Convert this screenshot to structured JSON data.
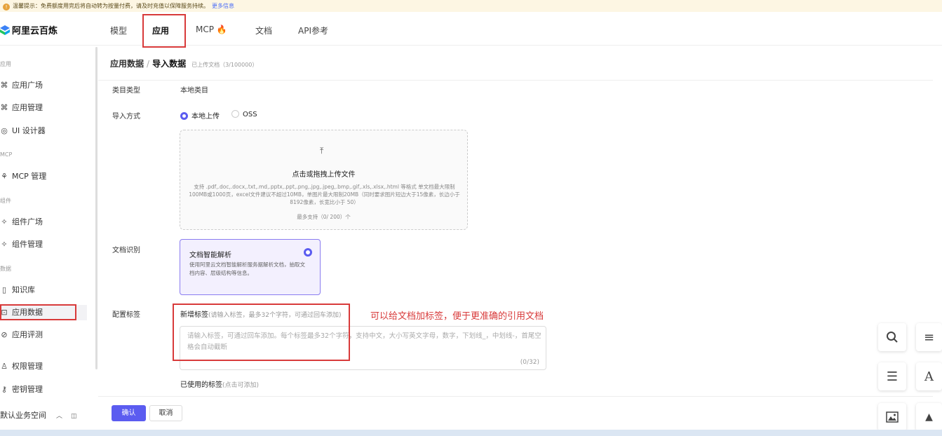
{
  "notice": {
    "text": "温馨提示：免费额度用完后将自动转为按量付费，请及时充值以保障服务持续。",
    "more": "更多信息"
  },
  "topbar": {
    "logo": "阿里云百炼",
    "nav": [
      "模型",
      "应用",
      "MCP",
      "文档",
      "API参考"
    ],
    "active_nav": "应用"
  },
  "sidebar": {
    "groups": {
      "app": "应用",
      "mcp": "MCP",
      "component": "组件",
      "data": "数据"
    },
    "items": {
      "app_plaza": "应用广场",
      "app_manage": "应用管理",
      "ui_designer": "UI 设计器",
      "mcp_manage": "MCP 管理",
      "comp_plaza": "组件广场",
      "comp_manage": "组件管理",
      "knowledge": "知识库",
      "app_data": "应用数据",
      "app_eval": "应用评测",
      "perm": "权限管理",
      "keys": "密钥管理"
    },
    "workspace": "默认业务空间"
  },
  "breadcrumb": {
    "parent": "应用数据",
    "separator": "/",
    "current": "导入数据",
    "meta": "已上传文档（3/100000）"
  },
  "form": {
    "category_label": "类目类型",
    "category_value": "本地类目",
    "import_label": "导入方式",
    "import_options": [
      "本地上传",
      "OSS"
    ],
    "import_selected": "本地上传",
    "upload": {
      "title": "点击或拖拽上传文件",
      "desc": "支持 .pdf,.doc,.docx,.txt,.md,.pptx,.ppt,.png,.jpg,.jpeg,.bmp,.gif,.xls,.xlsx,.html 等格式 单文档最大限制100MB或1000页，excel文件建议不超过10MB，单图片最大限制20MB（同时要求图片短边大于15像素，长边小于8192像素，长宽比小于 50）",
      "count": "最多支持（0/ 200）个"
    },
    "recog_label": "文档识别",
    "recog_card": {
      "title": "文档智能解析",
      "desc": "使用阿里云文档智能解析服务据解析文档，抽取文档内容、层级结构等信息。"
    },
    "tag_label": "配置标签",
    "tag_new": "新增标签",
    "tag_new_hint": "(请输入标签，最多32个字符，可通过回车添加)",
    "tag_placeholder": "请输入标签，可通过回车添加。每个标签最多32个字符，支持中文，大小写英文字母，数字，下划线_，中划线-，首尾空格会自动截断",
    "tag_count": "(0/32)",
    "used_tags": "已使用的标签",
    "used_tags_hint": "(点击可添加)",
    "annotation": "可以给文档加标签，便于更准确的引用文档"
  },
  "footer": {
    "confirm": "确认",
    "cancel": "取消"
  },
  "colors": {
    "accent": "#5b5cf0",
    "annotation": "#d83a3a"
  }
}
